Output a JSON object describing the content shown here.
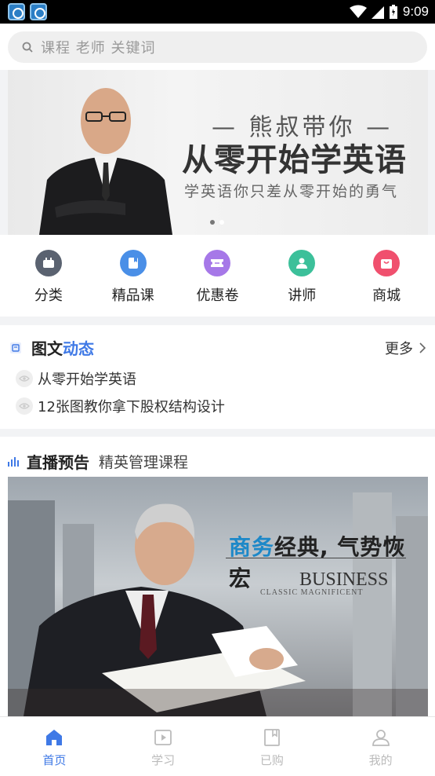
{
  "status_bar": {
    "time": "9:09"
  },
  "search": {
    "placeholder": "课程 老师 关键词"
  },
  "banner": {
    "subtitle": "— 熊叔带你 —",
    "title": "从零开始学英语",
    "tagline": "学英语你只差从零开始的勇气",
    "slide_count": 2,
    "active_slide": 1
  },
  "quick_nav": [
    {
      "label": "分类",
      "icon": "category-icon",
      "color": "#5a6270"
    },
    {
      "label": "精品课",
      "icon": "course-icon",
      "color": "#4a8fe7"
    },
    {
      "label": "优惠卷",
      "icon": "coupon-icon",
      "color": "#a678e8"
    },
    {
      "label": "讲师",
      "icon": "teacher-icon",
      "color": "#3cc09a"
    },
    {
      "label": "商城",
      "icon": "shop-icon",
      "color": "#f0506e"
    }
  ],
  "articles": {
    "title_a": "图文",
    "title_b": "动态",
    "more": "更多",
    "items": [
      {
        "title": "从零开始学英语"
      },
      {
        "title": "12张图教你拿下股权结构设计"
      }
    ]
  },
  "live": {
    "title": "直播预告",
    "subtitle": "精英管理课程",
    "image": {
      "title_a": "商务",
      "title_b": "经典, 气势恢宏",
      "english": "BUSINESS",
      "english_sub": "CLASSIC MAGNIFICENT"
    }
  },
  "tabs": [
    {
      "label": "首页",
      "active": true
    },
    {
      "label": "学习",
      "active": false
    },
    {
      "label": "已购",
      "active": false
    },
    {
      "label": "我的",
      "active": false
    }
  ],
  "colors": {
    "accent": "#3f79e6",
    "inactive": "#bbbbbb"
  }
}
